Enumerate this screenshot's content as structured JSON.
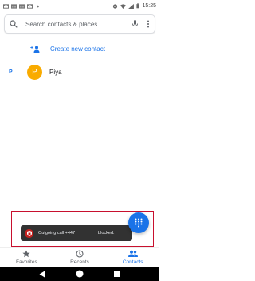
{
  "status_bar": {
    "time": "15:25"
  },
  "search": {
    "placeholder": "Search contacts & places"
  },
  "create_contact": {
    "label": "Create new contact"
  },
  "contacts": {
    "section_letter": "P",
    "items": [
      {
        "initial": "P",
        "name": "Piya",
        "avatar_color": "#f9ab00"
      }
    ]
  },
  "snackbar": {
    "message": "Outgoing call +447      blocked."
  },
  "bottom_nav": {
    "items": [
      {
        "label": "Favorites",
        "icon": "star-icon",
        "active": false
      },
      {
        "label": "Recents",
        "icon": "clock-icon",
        "active": false
      },
      {
        "label": "Contacts",
        "icon": "people-icon",
        "active": true
      }
    ]
  },
  "colors": {
    "accent": "#1a73e8",
    "avatar": "#f9ab00",
    "snackbar_bg": "#323232",
    "highlight": "#c8102e"
  }
}
